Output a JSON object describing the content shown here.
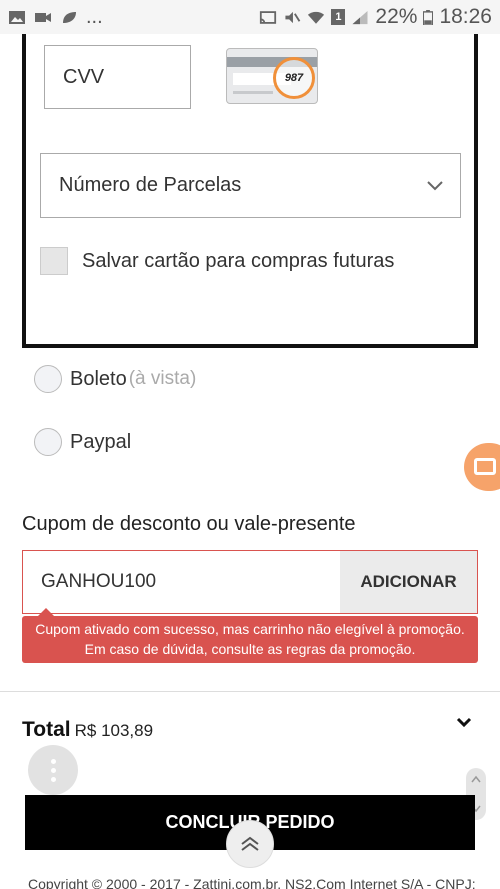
{
  "status_bar": {
    "icons": [
      "image-icon",
      "video-icon",
      "leaf-icon",
      "cast-icon",
      "mute-icon",
      "wifi-icon",
      "sim-icon",
      "signal-icon",
      "battery-icon"
    ],
    "overflow": "...",
    "sim_badge": "1",
    "battery": "22%",
    "time": "18:26"
  },
  "card_form": {
    "cvv_placeholder": "CVV",
    "cvv_example": "987",
    "installments_placeholder": "Número de Parcelas",
    "save_card_label": "Salvar cartão para compras futuras"
  },
  "payment_options": [
    {
      "label": "Boleto",
      "sublabel": "(à vista)"
    },
    {
      "label": "Paypal",
      "sublabel": ""
    }
  ],
  "coupon": {
    "title": "Cupom de desconto ou vale-presente",
    "value": "GANHOU100",
    "button": "ADICIONAR",
    "alert_line1": "Cupom ativado com sucesso, mas carrinho não elegível à promoção.",
    "alert_line2": "Em caso de dúvida, consulte as regras da promoção."
  },
  "summary": {
    "total_label": "Total",
    "total_value": "R$ 103,89",
    "conclude_button": "CONCLUIR PEDIDO"
  },
  "footer": {
    "copyright": "Copyright © 2000 - 2017 - Zattini.com.br. NS2.Com Internet S/A - CNPJ:"
  },
  "colors": {
    "error": "#d9534f",
    "primary_button": "#000000",
    "video_fab": "#f6a36a",
    "cvv_highlight": "#f0903a"
  }
}
